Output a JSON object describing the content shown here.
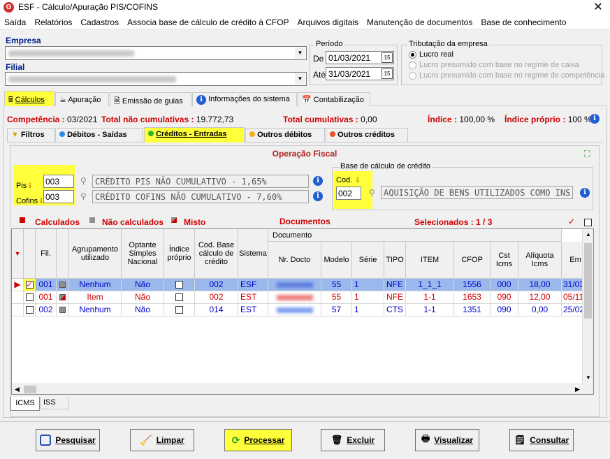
{
  "window": {
    "title": "ESF - Cálculo/Apuração PIS/COFINS",
    "logo": "G",
    "close": "✕"
  },
  "menu": [
    "Saída",
    "Relatórios",
    "Cadastros",
    "Associa base de cálculo de crédito à CFOP",
    "Arquivos digitais",
    "Manutenção de documentos",
    "Base de conhecimento"
  ],
  "empresa": {
    "label": "Empresa"
  },
  "filial": {
    "label": "Filial"
  },
  "periodo": {
    "title": "Período",
    "de_label": "De",
    "de": "01/03/2021",
    "ate_label": "Até",
    "ate": "31/03/2021"
  },
  "tributacao": {
    "title": "Tributação da empresa",
    "options": [
      "Lucro real",
      "Lucro presumido com base no regime de caixa",
      "Lucro presumido com base no regime de competência"
    ],
    "selected": 0
  },
  "main_tabs": [
    "Cálculos",
    "Apuração",
    "Emissão de guias",
    "Informações do sistema",
    "Contabilização"
  ],
  "summary": {
    "competencia_label": "Competência :",
    "competencia": "03/2021",
    "nao_cumul_label": "Total não cumulativas :",
    "nao_cumul": "19.772,73",
    "cumul_label": "Total cumulativas :",
    "cumul": "0,00",
    "indice_label": "Índice :",
    "indice": "100,00 %",
    "indice_proprio_label": "Índice próprio :",
    "indice_proprio": "100 %"
  },
  "sub_tabs": [
    "Filtros",
    "Débitos - Saídas",
    "Créditos - Entradas",
    "Outros débitos",
    "Outros créditos"
  ],
  "operacao": {
    "title": "Operação Fiscal",
    "pis_label": "Pis",
    "pis_code": "003",
    "pis_desc": "CRÉDITO PIS NÃO CUMULATIVO - 1,65%",
    "cofins_label": "Cofins",
    "cofins_code": "003",
    "cofins_desc": "CRÉDITO COFINS NÃO CUMULATIVO - 7,60%",
    "base_title": "Base de cálculo de crédito",
    "cod_label": "Cod.",
    "cod": "002",
    "base_desc": "AQUISIÇÃO DE BENS UTILIZADOS COMO INS"
  },
  "legend": {
    "calculados": "Calculados",
    "nao_calculados": "Não calculados",
    "misto": "Misto",
    "documentos": "Documentos",
    "selecionados": "Selecionados : 1 / 3"
  },
  "grid": {
    "group_header": "Documento",
    "columns": [
      "Fil.",
      "Agrupamento utilizado",
      "Optante Simples Nacional",
      "Índice próprio",
      "Cod. Base cálculo de crédito",
      "Sistema",
      "Nr. Docto",
      "Modelo",
      "Série",
      "TIPO",
      "ITEM",
      "CFOP",
      "Cst Icms",
      "Alíquota Icms",
      "Em"
    ],
    "rows": [
      {
        "fil": "001",
        "agrup": "Nenhum",
        "simples": "Não",
        "codbase": "002",
        "sistema": "ESF",
        "modelo": "55",
        "serie": "1",
        "tipo": "NFE",
        "item": "1_1_1",
        "cfop": "1556",
        "cst": "000",
        "aliq": "18,00",
        "em": "31/03"
      },
      {
        "fil": "001",
        "agrup": "Item",
        "simples": "Não",
        "codbase": "002",
        "sistema": "EST",
        "modelo": "55",
        "serie": "1",
        "tipo": "NFE",
        "item": "1-1",
        "cfop": "1653",
        "cst": "090",
        "aliq": "12,00",
        "em": "05/11"
      },
      {
        "fil": "002",
        "agrup": "Nenhum",
        "simples": "Não",
        "codbase": "014",
        "sistema": "EST",
        "modelo": "57",
        "serie": "1",
        "tipo": "CTS",
        "item": "1-1",
        "cfop": "1351",
        "cst": "090",
        "aliq": "0,00",
        "em": "25/02"
      }
    ]
  },
  "bottom_tabs": [
    "ICMS",
    "ISS"
  ],
  "buttons": [
    "Pesquisar",
    "Limpar",
    "Processar",
    "Excluir",
    "Visualizar",
    "Consultar"
  ],
  "colors": {
    "highlight": "#ffff3c",
    "selected_row": "#9ab8ec",
    "red": "#d00000",
    "blue": "#0000c8"
  }
}
